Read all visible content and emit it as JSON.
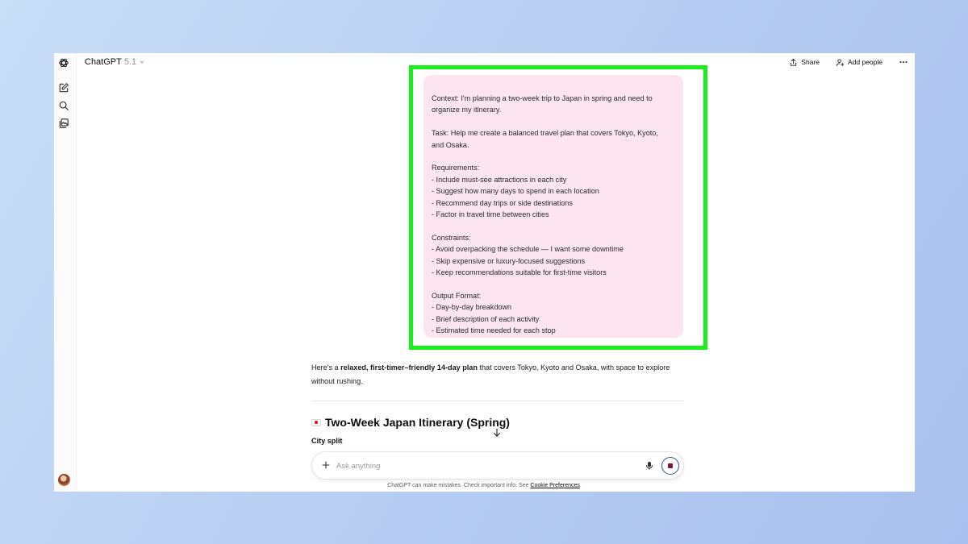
{
  "app": {
    "name": "ChatGPT",
    "model_version": "5.1"
  },
  "icons": {
    "logo": "openai-logo-icon",
    "new_chat": "pencil-square-icon",
    "search": "search-icon",
    "library": "images-icon",
    "share": "share-upload-icon",
    "add_people": "person-plus-icon",
    "more": "ellipsis-icon",
    "scroll_down": "arrow-down-icon",
    "attach": "plus-icon",
    "voice": "microphone-icon",
    "stop": "stop-icon"
  },
  "header": {
    "share_label": "Share",
    "add_people_label": "Add people"
  },
  "user_message": {
    "lines": [
      "Context: I'm planning a two-week trip to Japan in spring and need to",
      "organize my itinerary.",
      "",
      "Task: Help me create a balanced travel plan that covers Tokyo, Kyoto,",
      "and Osaka.",
      "",
      "Requirements:",
      "- Include must-see attractions in each city",
      "- Suggest how many days to spend in each location",
      "- Recommend day trips or side destinations",
      "- Factor in travel time between cities",
      "",
      "Constraints:",
      "- Avoid overpacking the schedule — I want some downtime",
      "- Skip expensive or luxury-focused suggestions",
      "- Keep recommendations suitable for first-time visitors",
      "",
      "Output Format:",
      "- Day-by-day breakdown",
      "- Brief description of each activity",
      "- Estimated time needed for each stop"
    ]
  },
  "assistant_reply": {
    "intro_prefix": "Here's a ",
    "intro_bold": "relaxed, first-timer–friendly 14-day plan",
    "intro_suffix": " that covers Tokyo, Kyoto and Osaka, with space to explore without rushing.",
    "heading": "Two-Week Japan Itinerary (Spring)",
    "subheading": "City split"
  },
  "composer": {
    "placeholder": "Ask anything"
  },
  "footer": {
    "disclaimer_prefix": "ChatGPT can make mistakes. Check important info. See ",
    "cookie_link": "Cookie Preferences",
    "disclaimer_suffix": "."
  },
  "colors": {
    "highlight_border": "#19ef19",
    "user_bubble": "#fce4f1",
    "background": "#b9cff3"
  }
}
